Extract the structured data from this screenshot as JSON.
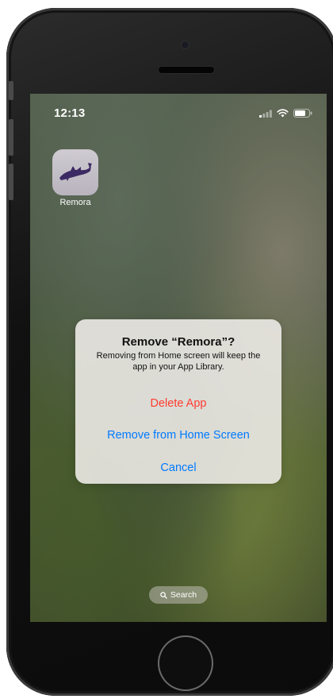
{
  "status_bar": {
    "time": "12:13",
    "signal_icon": "signal-icon",
    "wifi_icon": "wifi-icon",
    "battery_icon": "battery-icon"
  },
  "home_screen": {
    "apps": [
      {
        "label": "Remora",
        "icon": "remora-fish-icon"
      }
    ],
    "search": {
      "label": "Search",
      "icon": "magnifier-icon"
    }
  },
  "alert": {
    "title": "Remove “Remora”?",
    "message": "Removing from Home screen will keep the app in your App Library.",
    "actions": [
      {
        "label": "Delete App",
        "style": "destructive",
        "color": "#ff3b30"
      },
      {
        "label": "Remove from Home Screen",
        "style": "default",
        "color": "#007aff"
      },
      {
        "label": "Cancel",
        "style": "default",
        "color": "#007aff"
      }
    ]
  },
  "colors": {
    "destructive": "#ff3b30",
    "tint": "#007aff",
    "alert_background": "#eceae6"
  }
}
